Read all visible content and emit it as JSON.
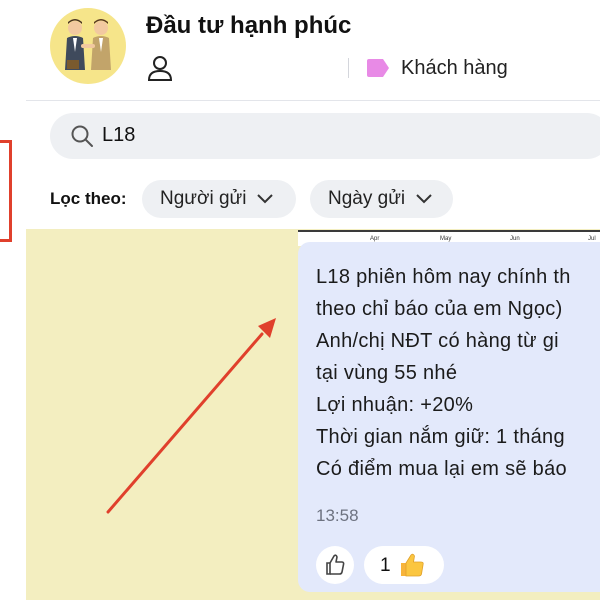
{
  "header": {
    "title": "Đầu tư hạnh phúc",
    "avatar_icon": "business-handshake-icon",
    "person_icon": "person-icon",
    "tag": {
      "label": "Khách hàng",
      "color": "#e88ae6",
      "icon": "tag-icon"
    }
  },
  "search": {
    "value": "L18",
    "icon": "search-icon"
  },
  "filter": {
    "label": "Lọc theo:",
    "chips": [
      {
        "label": "Người gửi",
        "icon": "chevron-down-icon"
      },
      {
        "label": "Ngày gửi",
        "icon": "chevron-down-icon"
      }
    ]
  },
  "chart_snippet": {
    "months": [
      "Apr",
      "May",
      "Jun",
      "Jul"
    ]
  },
  "message": {
    "lines": [
      "L18 phiên hôm nay chính th",
      "theo chỉ báo của em Ngọc)",
      "Anh/chị NĐT có hàng từ gi",
      "tại vùng 55 nhé",
      "Lợi nhuận: +20%",
      "Thời gian nắm giữ: 1 tháng",
      "Có điểm mua lại em sẽ báo"
    ],
    "time": "13:58",
    "reactions": {
      "like_icon": "thumbs-up-outline-icon",
      "count": "1",
      "emoji_icon": "thumbs-up-emoji-icon"
    }
  },
  "colors": {
    "accent_red": "#e0402c",
    "bubble": "#e3e9fb",
    "background": "#f3eec0"
  }
}
